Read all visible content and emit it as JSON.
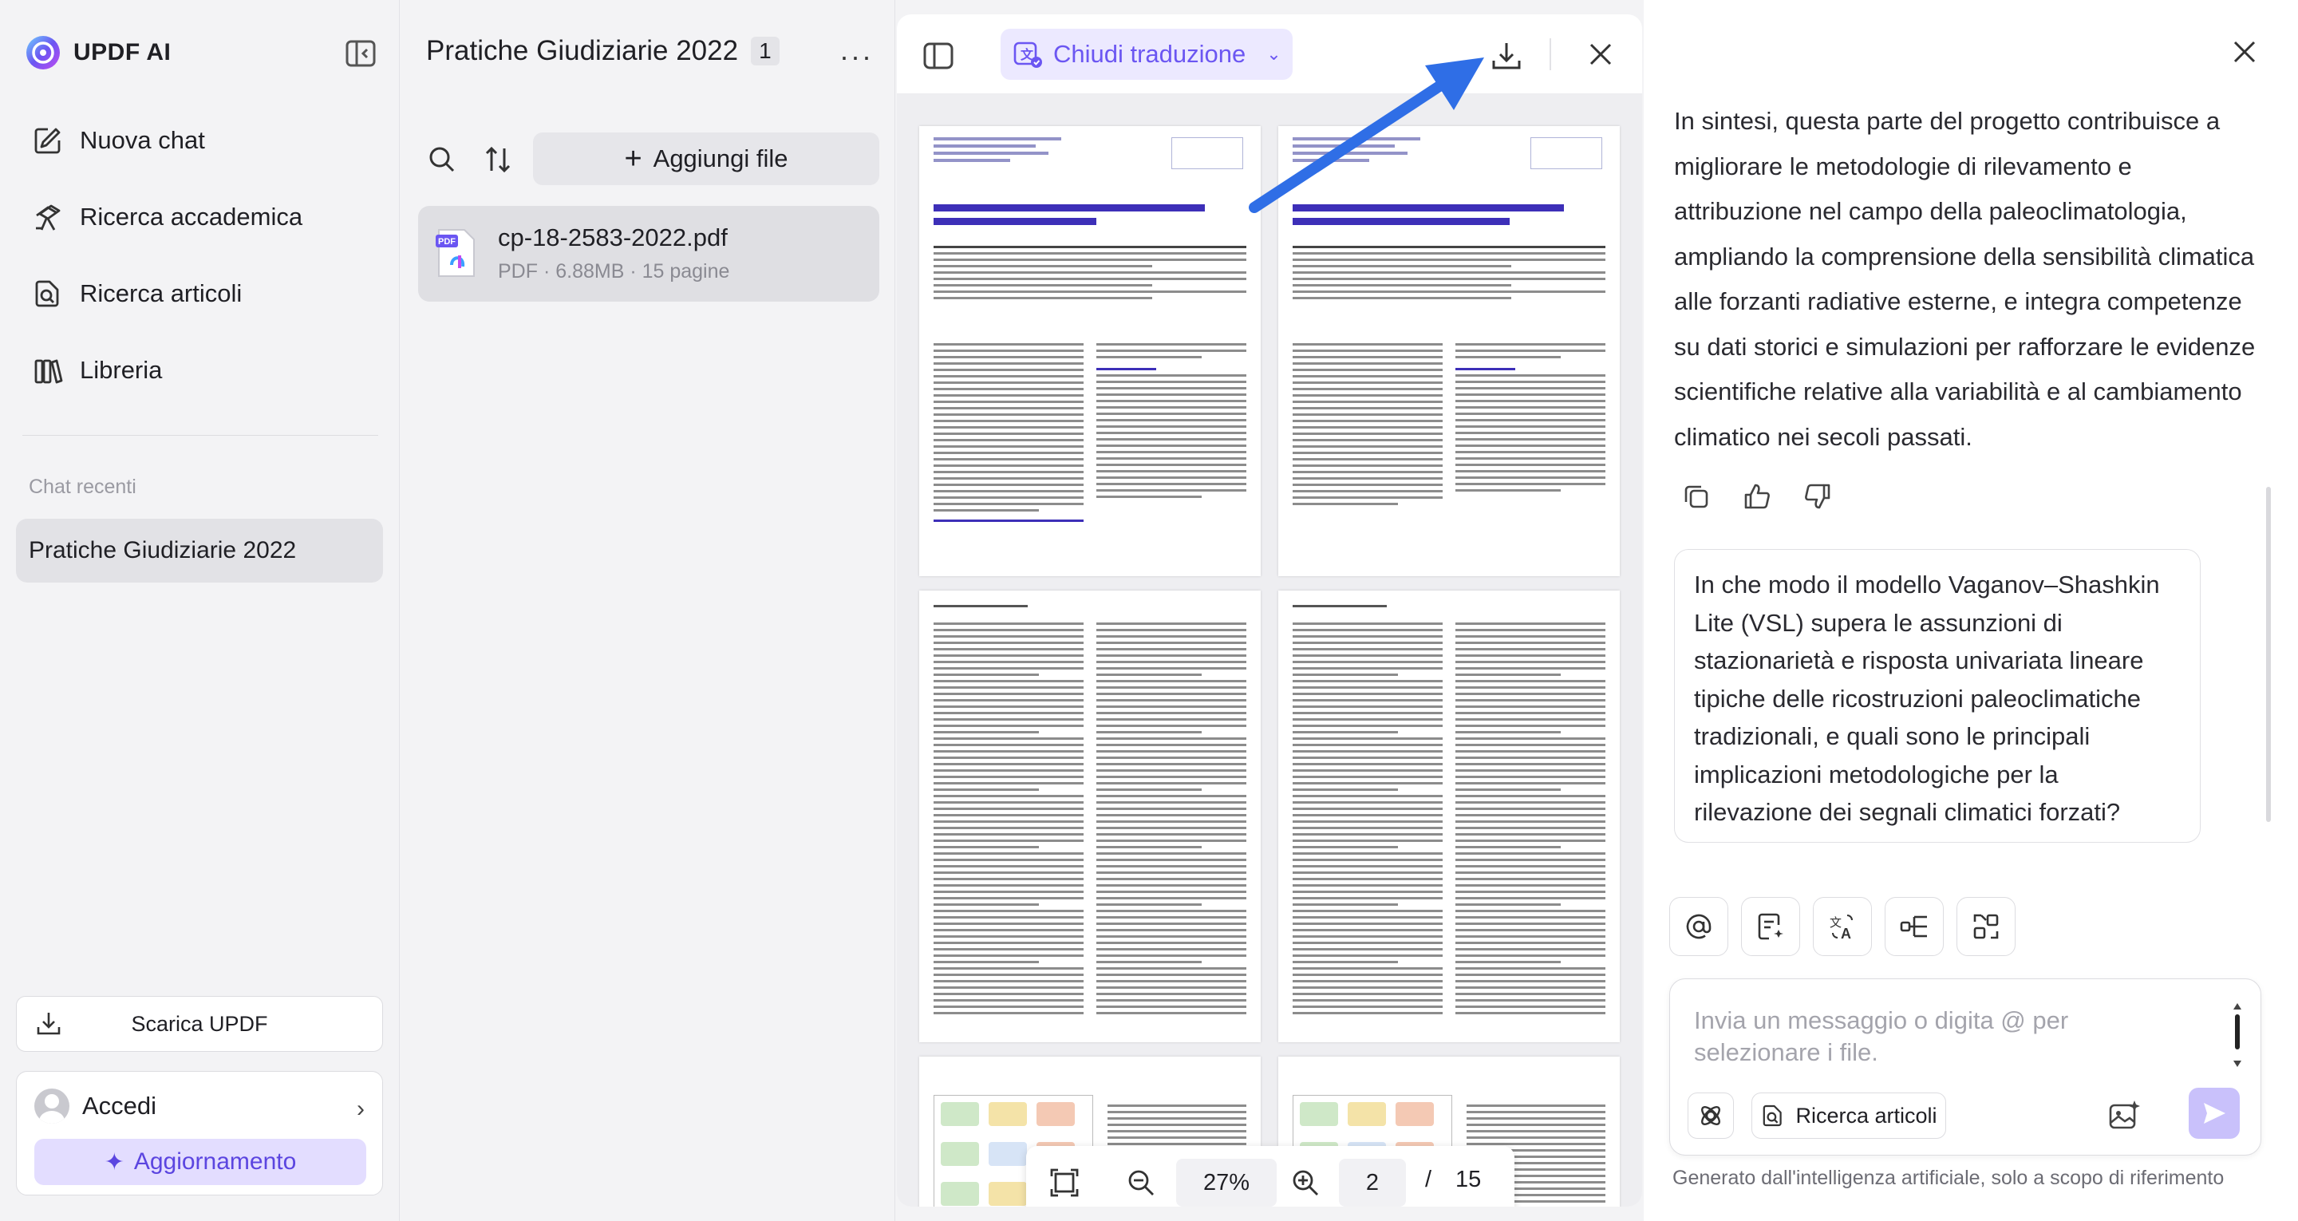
{
  "sidebar": {
    "brand": "UPDF AI",
    "nav": [
      {
        "label": "Nuova chat",
        "icon": "new-chat-icon"
      },
      {
        "label": "Ricerca accademica",
        "icon": "academic-research-icon"
      },
      {
        "label": "Ricerca articoli",
        "icon": "article-search-icon"
      },
      {
        "label": "Libreria",
        "icon": "library-icon"
      }
    ],
    "recent_label": "Chat recenti",
    "recent_items": [
      "Pratiche Giudiziarie 2022"
    ],
    "download_label": "Scarica UPDF",
    "account_label": "Accedi",
    "upgrade_label": "Aggiornamento"
  },
  "files": {
    "title": "Pratiche Giudiziarie 2022",
    "count": "1",
    "add_label": "Aggiungi file",
    "items": [
      {
        "name": "cp-18-2583-2022.pdf",
        "meta": "PDF · 6.88MB · 15 pagine",
        "badge": "PDF"
      }
    ]
  },
  "viewer": {
    "translate_label": "Chiudi traduzione",
    "zoom": "27%",
    "current_page": "2",
    "separator": "/",
    "total_pages": "15"
  },
  "chat": {
    "answer": "In sintesi, questa parte del progetto contribuisce a migliorare le metodologie di rilevamento e attribuzione nel campo della paleoclimatologia, ampliando la comprensione della sensibilità climatica alle forzanti radiative esterne, e integra competenze su dati storici e simulazioni per rafforzare le evidenze scientifiche relative alla variabilità e al cambiamento climatico nei secoli passati.",
    "question": "In che modo il modello Vaganov–Shashkin Lite (VSL) supera le assunzioni di stazionarietà e risposta univariata lineare tipiche delle ricostruzioni paleoclimatiche tradizionali, e quali sono le principali implicazioni metodologiche per la rilevazione dei segnali climatici forzati?",
    "input_placeholder": "Invia un messaggio o digita @ per selezionare i file.",
    "research_label": "Ricerca articoli",
    "disclaimer": "Generato dall'intelligenza artificiale, solo a scopo di riferimento"
  },
  "colors": {
    "accent": "#6b56f2",
    "accent_light": "#ece9ff",
    "arrow": "#2f6ee6"
  }
}
